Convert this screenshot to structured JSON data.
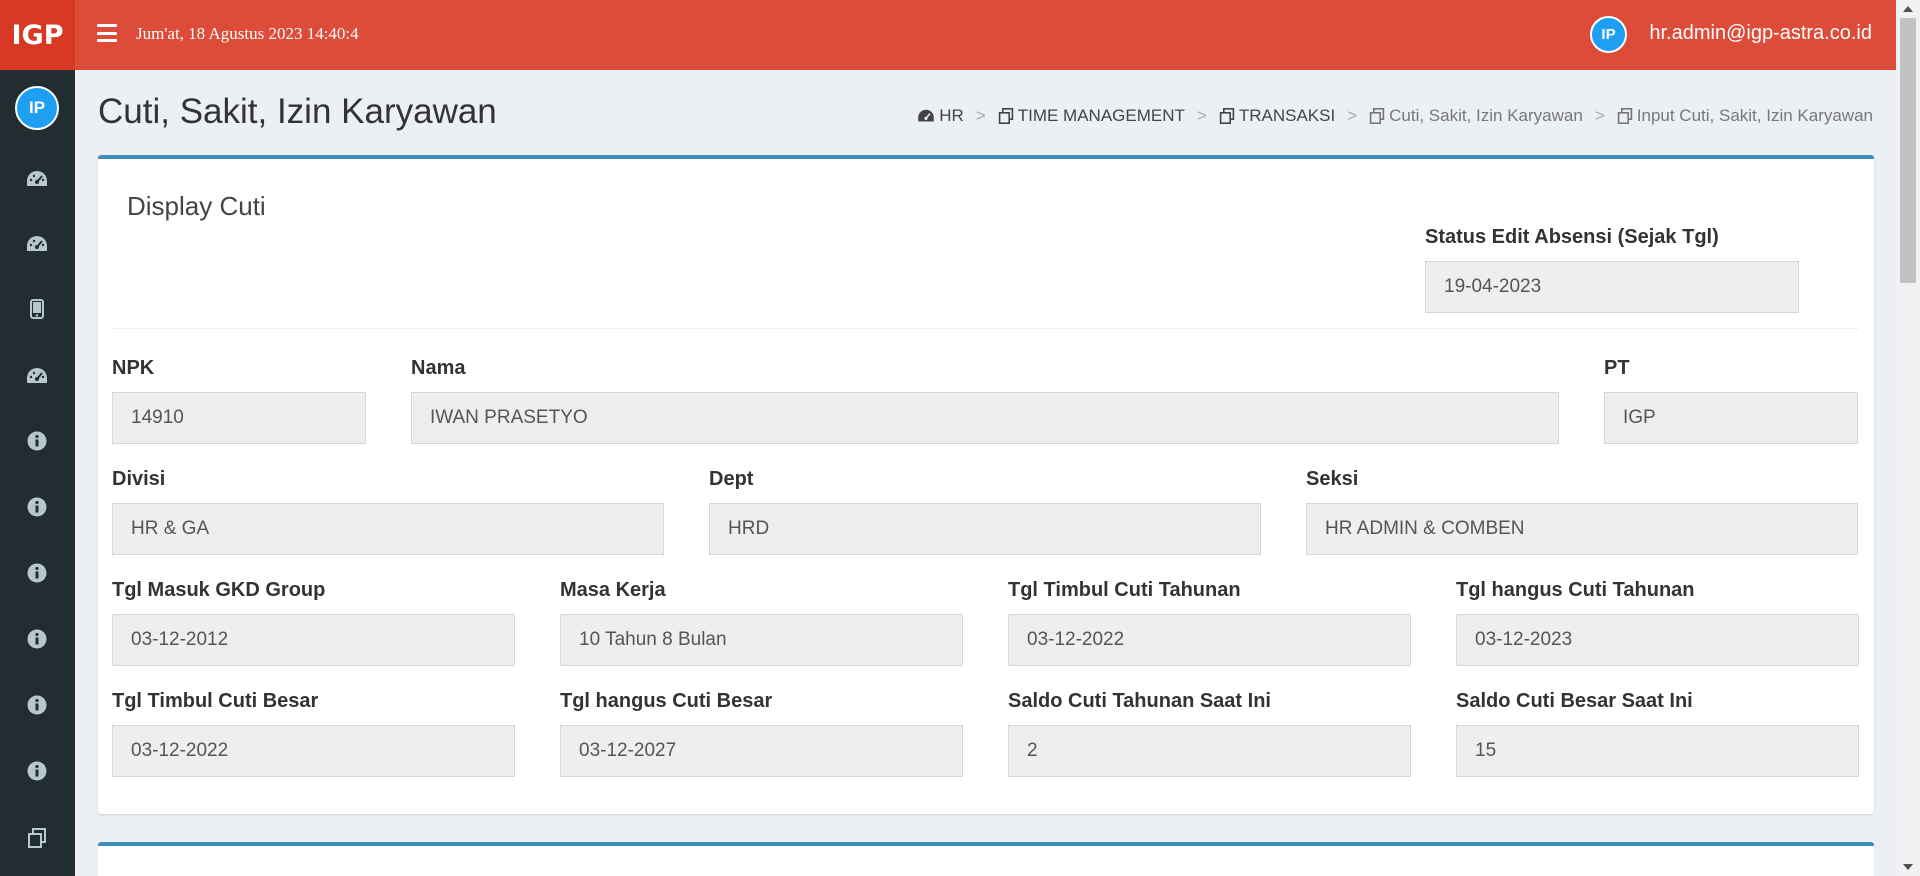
{
  "header": {
    "logo": "IGP",
    "datetime": "Jum'at, 18 Agustus 2023 14:40:4",
    "user_initials": "IP",
    "user_email": "hr.admin@igp-astra.co.id"
  },
  "sidebar": {
    "avatar_initials": "IP",
    "items": [
      {
        "icon": "dashboard-icon"
      },
      {
        "icon": "dashboard-icon"
      },
      {
        "icon": "mobile-icon"
      },
      {
        "icon": "dashboard-icon"
      },
      {
        "icon": "info-icon"
      },
      {
        "icon": "info-icon"
      },
      {
        "icon": "info-icon"
      },
      {
        "icon": "info-icon"
      },
      {
        "icon": "info-icon"
      },
      {
        "icon": "info-icon"
      },
      {
        "icon": "copy-icon"
      }
    ]
  },
  "page": {
    "title": "Cuti, Sakit, Izin Karyawan",
    "breadcrumb": [
      "HR",
      "TIME MANAGEMENT",
      "TRANSAKSI",
      "Cuti, Sakit, Izin Karyawan",
      "Input Cuti, Sakit, Izin Karyawan"
    ]
  },
  "box": {
    "title": "Display Cuti",
    "status_edit": {
      "label": "Status Edit Absensi (Sejak Tgl)",
      "value": "19-04-2023"
    },
    "npk": {
      "label": "NPK",
      "value": "14910"
    },
    "nama": {
      "label": "Nama",
      "value": "IWAN PRASETYO"
    },
    "pt": {
      "label": "PT",
      "value": "IGP"
    },
    "divisi": {
      "label": "Divisi",
      "value": "HR & GA"
    },
    "dept": {
      "label": "Dept",
      "value": "HRD"
    },
    "seksi": {
      "label": "Seksi",
      "value": "HR ADMIN & COMBEN"
    },
    "tgl_masuk": {
      "label": "Tgl Masuk GKD Group",
      "value": "03-12-2012"
    },
    "masa_kerja": {
      "label": "Masa Kerja",
      "value": "10 Tahun 8 Bulan"
    },
    "tgl_timbul_tahunan": {
      "label": "Tgl Timbul Cuti Tahunan",
      "value": "03-12-2022"
    },
    "tgl_hangus_tahunan": {
      "label": "Tgl hangus Cuti Tahunan",
      "value": "03-12-2023"
    },
    "tgl_timbul_besar": {
      "label": "Tgl Timbul Cuti Besar",
      "value": "03-12-2022"
    },
    "tgl_hangus_besar": {
      "label": "Tgl hangus Cuti Besar",
      "value": "03-12-2027"
    },
    "saldo_tahunan": {
      "label": "Saldo Cuti Tahunan Saat Ini",
      "value": "2"
    },
    "saldo_besar": {
      "label": "Saldo Cuti Besar Saat Ini",
      "value": "15"
    }
  },
  "colors": {
    "header": "#dd4b39",
    "logo": "#d73925",
    "sidebar": "#222d32",
    "box_accent": "#3c8dbc",
    "avatar": "#1e9ff2"
  }
}
